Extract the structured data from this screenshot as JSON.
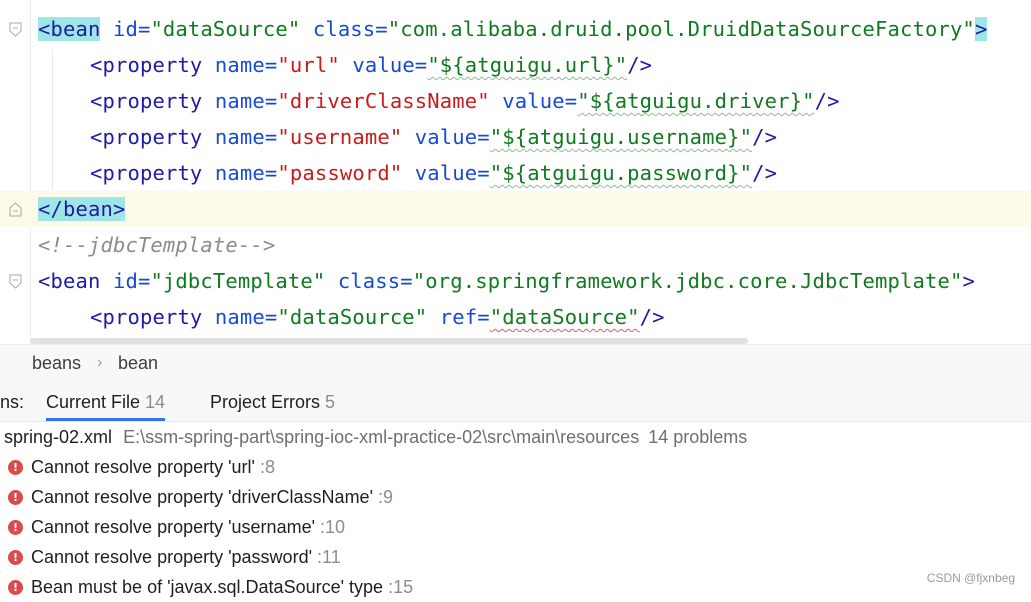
{
  "editor": {
    "lines": [
      {
        "parts": [
          "<bean",
          " id=",
          "\"dataSource\"",
          " class=",
          "\"com.alibaba.druid.pool.DruidDataSourceFactory\"",
          ">"
        ]
      },
      {
        "parts": [
          "<property",
          " name=",
          "\"url\"",
          " value=",
          "\"${atguigu.url}\"",
          "/>"
        ]
      },
      {
        "parts": [
          "<property",
          " name=",
          "\"driverClassName\"",
          " value=",
          "\"${atguigu.driver}\"",
          "/>"
        ]
      },
      {
        "parts": [
          "<property",
          " name=",
          "\"username\"",
          " value=",
          "\"${atguigu.username}\"",
          "/>"
        ]
      },
      {
        "parts": [
          "<property",
          " name=",
          "\"password\"",
          " value=",
          "\"${atguigu.password}\"",
          "/>"
        ]
      },
      {
        "parts": [
          "</bean",
          ">"
        ]
      },
      {
        "parts": [
          "<!--jdbcTemplate-->"
        ]
      },
      {
        "parts": [
          "<bean",
          " id=",
          "\"jdbcTemplate\"",
          " class=",
          "\"org.springframework.jdbc.core.JdbcTemplate\"",
          ">"
        ]
      },
      {
        "parts": [
          "<property",
          " name=",
          "\"dataSource\"",
          " ref=",
          "\"dataSource\"",
          "/>"
        ]
      }
    ]
  },
  "breadcrumb": {
    "items": [
      "beans",
      "bean"
    ],
    "separator": "›"
  },
  "tabs": {
    "prefix": "ns:",
    "items": [
      {
        "label": "Current File",
        "count": "14"
      },
      {
        "label": "Project Errors",
        "count": "5"
      }
    ]
  },
  "problems": {
    "file": {
      "name": "spring-02.xml",
      "path": "E:\\ssm-spring-part\\spring-ioc-xml-practice-02\\src\\main\\resources",
      "summary": "14 problems"
    },
    "items": [
      {
        "message": "Cannot resolve property 'url'",
        "line": ":8"
      },
      {
        "message": "Cannot resolve property 'driverClassName'",
        "line": ":9"
      },
      {
        "message": "Cannot resolve property 'username'",
        "line": ":10"
      },
      {
        "message": "Cannot resolve property 'password'",
        "line": ":11"
      },
      {
        "message": "Bean must be of 'javax.sql.DataSource' type",
        "line": ":15"
      }
    ],
    "error_icon": "!"
  },
  "watermark": "CSDN @fjxnbeg",
  "colors": {
    "tag": "#1f1aa5",
    "attr": "#174ad4",
    "value": "#107a1f",
    "error": "#d94c4c",
    "tab_accent": "#3574f0"
  }
}
